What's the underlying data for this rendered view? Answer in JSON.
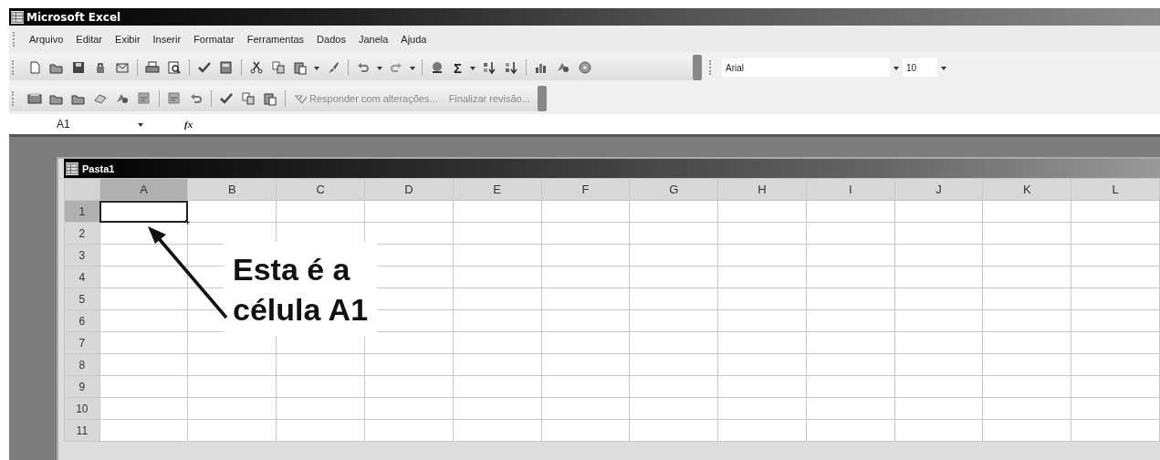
{
  "window": {
    "title": "Microsoft Excel"
  },
  "menu": [
    "Arquivo",
    "Editar",
    "Exibir",
    "Inserir",
    "Formatar",
    "Ferramentas",
    "Dados",
    "Janela",
    "Ajuda"
  ],
  "toolbar": {
    "sum_symbol": "Σ",
    "font": {
      "value": "Arial"
    },
    "font_size": {
      "value": "10"
    }
  },
  "review_toolbar": {
    "actions": [
      "Responder com alterações...",
      "Finalizar revisão..."
    ]
  },
  "formula_bar": {
    "name_box": "A1",
    "function_label": "fx"
  },
  "workbook": {
    "title": "Pasta1",
    "columns": [
      {
        "label": "A",
        "selected": true
      },
      {
        "label": "B",
        "selected": false
      },
      {
        "label": "C",
        "selected": false
      },
      {
        "label": "D",
        "selected": false
      },
      {
        "label": "E",
        "selected": false
      },
      {
        "label": "F",
        "selected": false
      },
      {
        "label": "G",
        "selected": false
      },
      {
        "label": "H",
        "selected": false
      },
      {
        "label": "I",
        "selected": false
      },
      {
        "label": "J",
        "selected": false
      },
      {
        "label": "K",
        "selected": false
      },
      {
        "label": "L",
        "selected": false
      }
    ],
    "rows": [
      {
        "label": "1",
        "selected": true
      },
      {
        "label": "2",
        "selected": false
      },
      {
        "label": "3",
        "selected": false
      },
      {
        "label": "4",
        "selected": false
      },
      {
        "label": "5",
        "selected": false
      },
      {
        "label": "6",
        "selected": false
      },
      {
        "label": "7",
        "selected": false
      },
      {
        "label": "8",
        "selected": false
      },
      {
        "label": "9",
        "selected": false
      },
      {
        "label": "10",
        "selected": false
      },
      {
        "label": "11",
        "selected": false
      }
    ]
  },
  "callout": {
    "lines": [
      "Esta é a",
      "célula A1"
    ]
  }
}
